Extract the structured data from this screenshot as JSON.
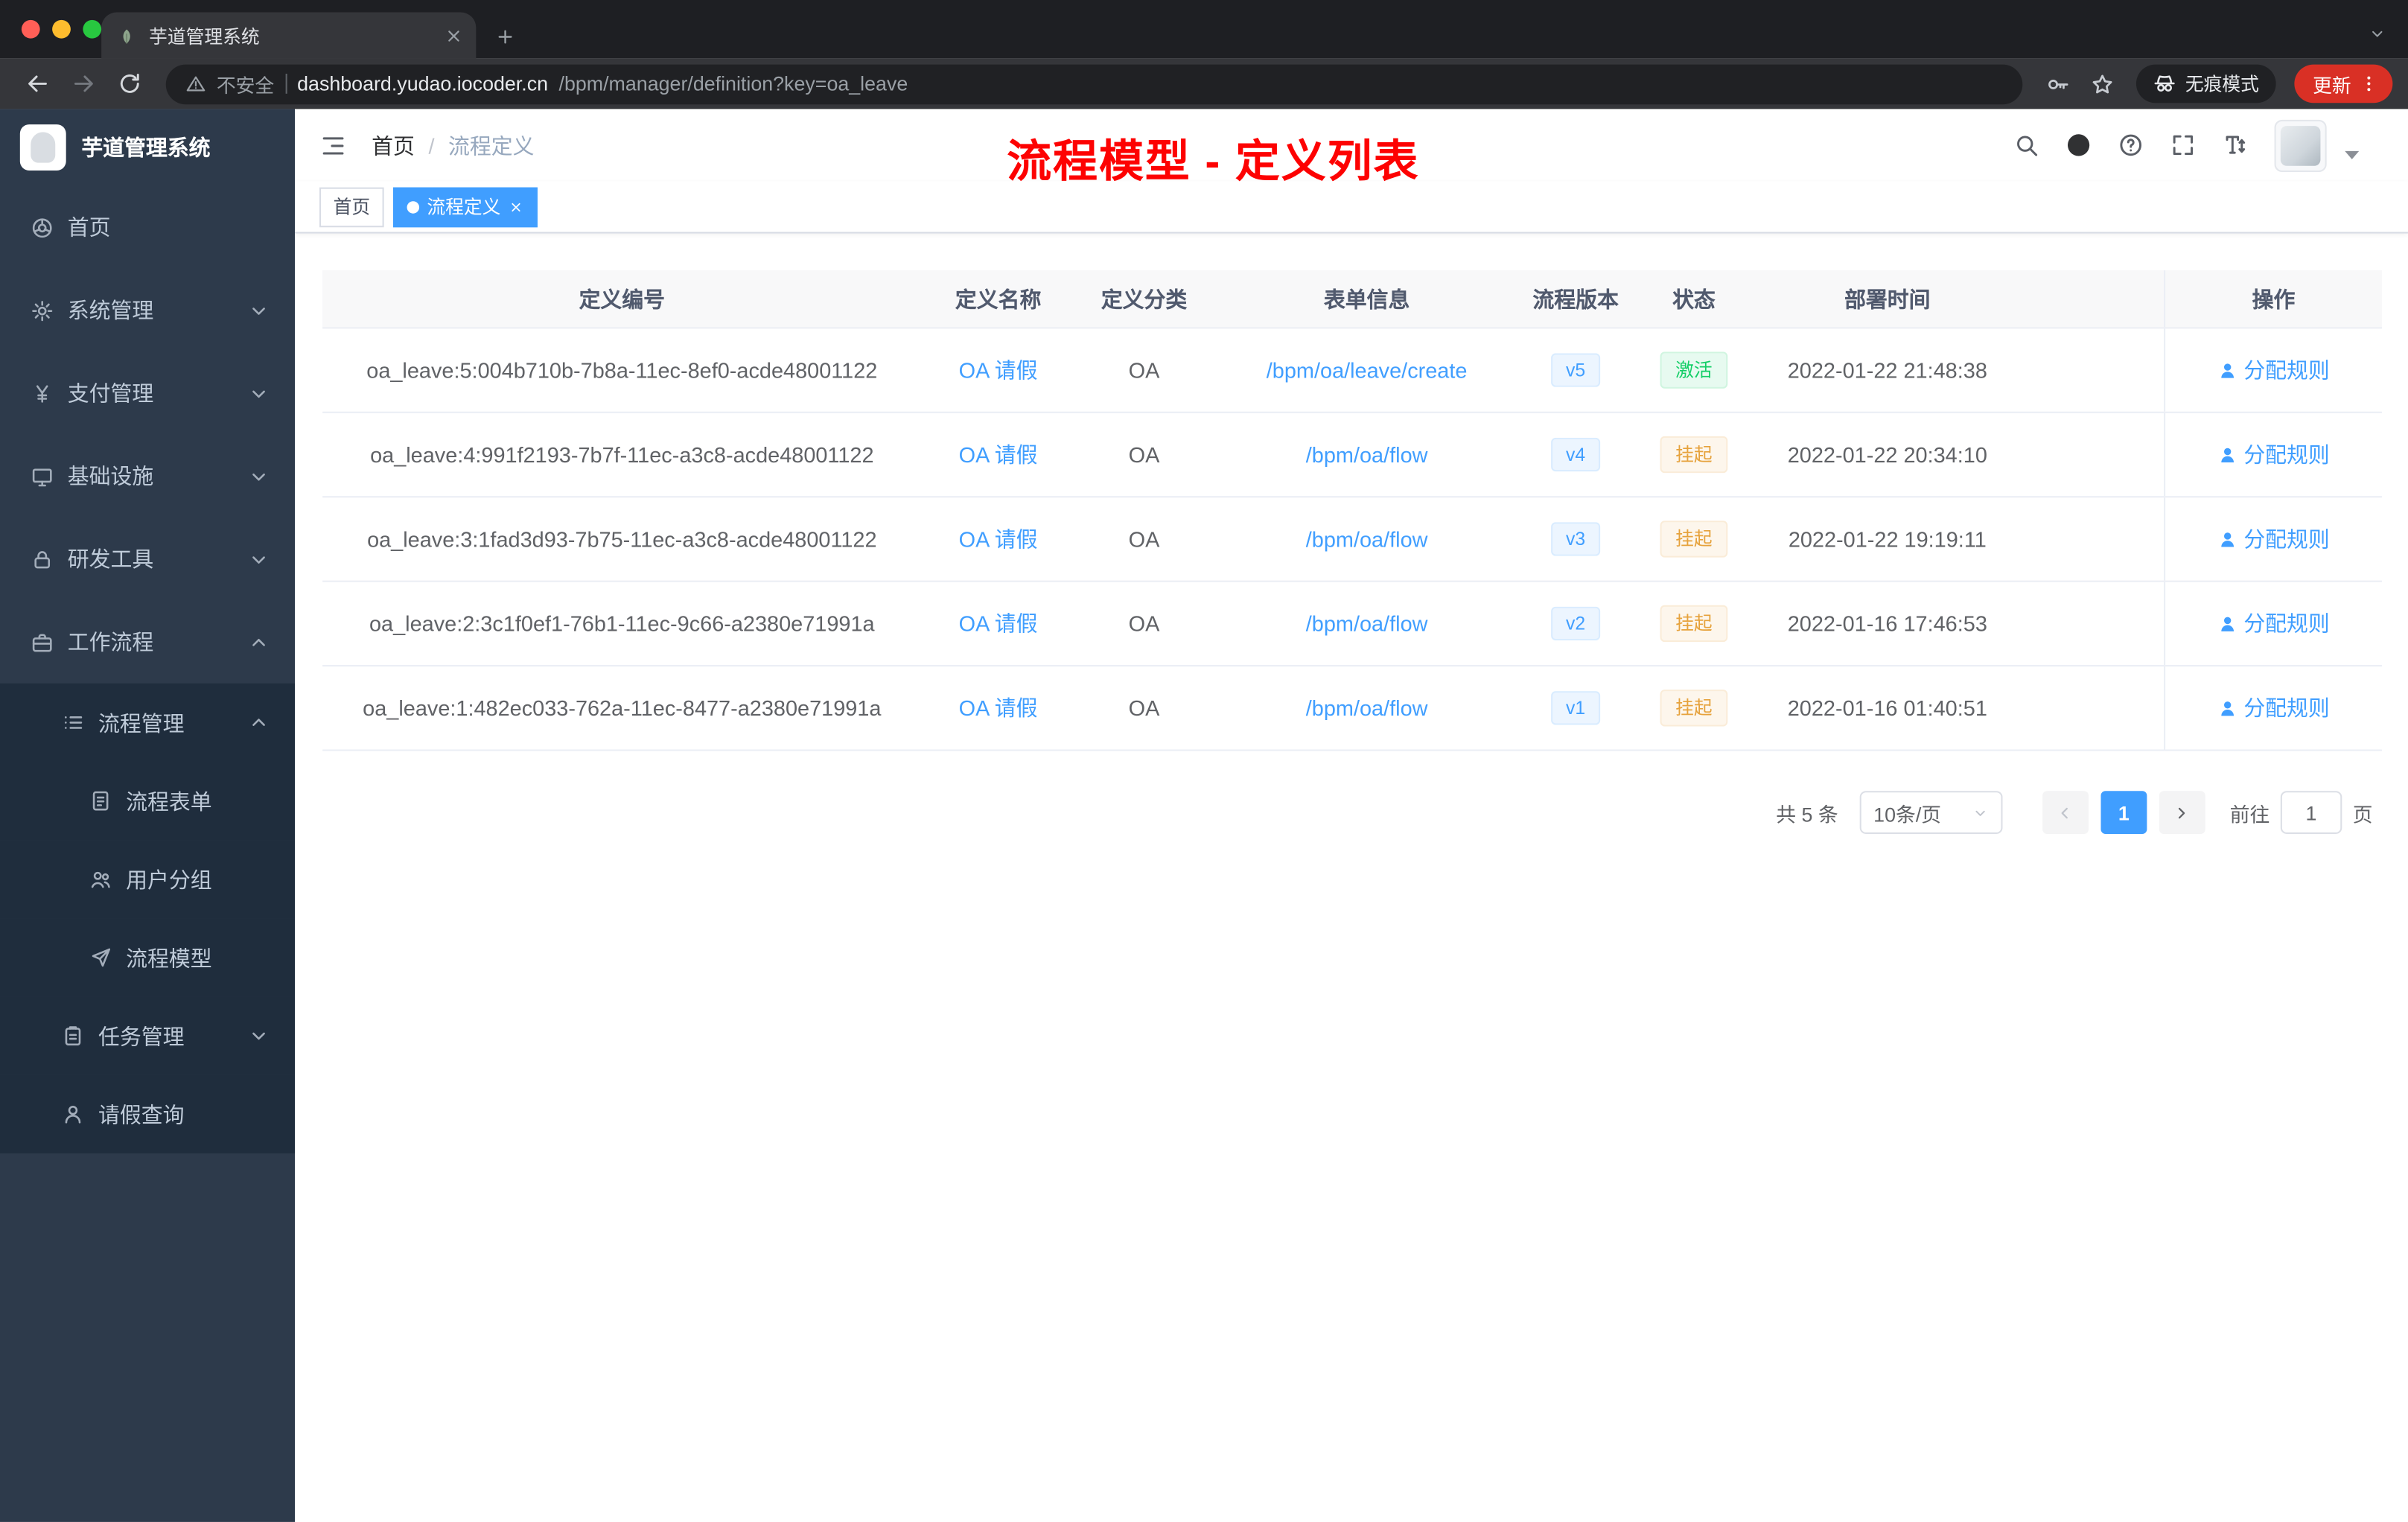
{
  "colors": {
    "accent": "#409eff",
    "success": "#13ce66",
    "warning": "#e6a23c",
    "annotation_red": "#fd0202",
    "update_pill": "#d93025",
    "sidebar_bg": "#2d3a4b",
    "submenu_bg": "#1f2d3d"
  },
  "browser": {
    "tab_title": "芋道管理系统",
    "address": {
      "security_label": "不安全",
      "host": "dashboard.yudao.iocoder.cn",
      "path": "/bpm/manager/definition?key=oa_leave"
    },
    "incognito_label": "无痕模式",
    "update_label": "更新"
  },
  "sidebar": {
    "logo_title": "芋道管理系统",
    "items": [
      {
        "id": "home",
        "icon": "home-icon",
        "label": "首页",
        "level": 1
      },
      {
        "id": "system-management",
        "icon": "gear-icon",
        "label": "系统管理",
        "level": 1,
        "chevron": "down"
      },
      {
        "id": "payment-management",
        "icon": "yen-icon",
        "label": "支付管理",
        "level": 1,
        "chevron": "down"
      },
      {
        "id": "infrastructure",
        "icon": "monitor-icon",
        "label": "基础设施",
        "level": 1,
        "chevron": "down"
      },
      {
        "id": "dev-tools",
        "icon": "lock-icon",
        "label": "研发工具",
        "level": 1,
        "chevron": "down"
      },
      {
        "id": "workflow",
        "icon": "briefcase-icon",
        "label": "工作流程",
        "level": 1,
        "chevron": "up"
      },
      {
        "id": "process-management",
        "icon": "list-icon",
        "label": "流程管理",
        "level": 2,
        "chevron": "up",
        "submenu": true
      },
      {
        "id": "process-form",
        "icon": "document-icon",
        "label": "流程表单",
        "level": 3,
        "submenu": true
      },
      {
        "id": "user-group",
        "icon": "users-icon",
        "label": "用户分组",
        "level": 3,
        "submenu": true
      },
      {
        "id": "process-model",
        "icon": "paper-plane-icon",
        "label": "流程模型",
        "level": 3,
        "submenu": true
      },
      {
        "id": "task-management",
        "icon": "clipboard-icon",
        "label": "任务管理",
        "level": 2,
        "chevron": "down",
        "submenu": true
      },
      {
        "id": "leave-query",
        "icon": "person-icon",
        "label": "请假查询",
        "level": 2,
        "submenu": true
      }
    ]
  },
  "header": {
    "breadcrumb": [
      "首页",
      "流程定义"
    ],
    "breadcrumb_separator": "/",
    "annotation": "流程模型 - 定义列表"
  },
  "tags": [
    {
      "id": "home",
      "label": "首页",
      "active": false,
      "closable": false
    },
    {
      "id": "process-definition",
      "label": "流程定义",
      "active": true,
      "closable": true
    }
  ],
  "table": {
    "columns": [
      "定义编号",
      "定义名称",
      "定义分类",
      "表单信息",
      "流程版本",
      "状态",
      "部署时间",
      "操作"
    ],
    "rows": [
      {
        "id": "oa_leave:5:004b710b-7b8a-11ec-8ef0-acde48001122",
        "name": "OA 请假",
        "category": "OA",
        "form": "/bpm/oa/leave/create",
        "version": "v5",
        "status": "激活",
        "status_type": "success",
        "time": "2022-01-22 21:48:38",
        "action": "分配规则"
      },
      {
        "id": "oa_leave:4:991f2193-7b7f-11ec-a3c8-acde48001122",
        "name": "OA 请假",
        "category": "OA",
        "form": "/bpm/oa/flow",
        "version": "v4",
        "status": "挂起",
        "status_type": "warning",
        "time": "2022-01-22 20:34:10",
        "action": "分配规则"
      },
      {
        "id": "oa_leave:3:1fad3d93-7b75-11ec-a3c8-acde48001122",
        "name": "OA 请假",
        "category": "OA",
        "form": "/bpm/oa/flow",
        "version": "v3",
        "status": "挂起",
        "status_type": "warning",
        "time": "2022-01-22 19:19:11",
        "action": "分配规则"
      },
      {
        "id": "oa_leave:2:3c1f0ef1-76b1-11ec-9c66-a2380e71991a",
        "name": "OA 请假",
        "category": "OA",
        "form": "/bpm/oa/flow",
        "version": "v2",
        "status": "挂起",
        "status_type": "warning",
        "time": "2022-01-16 17:46:53",
        "action": "分配规则"
      },
      {
        "id": "oa_leave:1:482ec033-762a-11ec-8477-a2380e71991a",
        "name": "OA 请假",
        "category": "OA",
        "form": "/bpm/oa/flow",
        "version": "v1",
        "status": "挂起",
        "status_type": "warning",
        "time": "2022-01-16 01:40:51",
        "action": "分配规则"
      }
    ]
  },
  "pagination": {
    "total": "共 5 条",
    "page_size": "10条/页",
    "current_page": "1",
    "goto_label": "前往",
    "goto_value": "1",
    "page_unit": "页"
  }
}
